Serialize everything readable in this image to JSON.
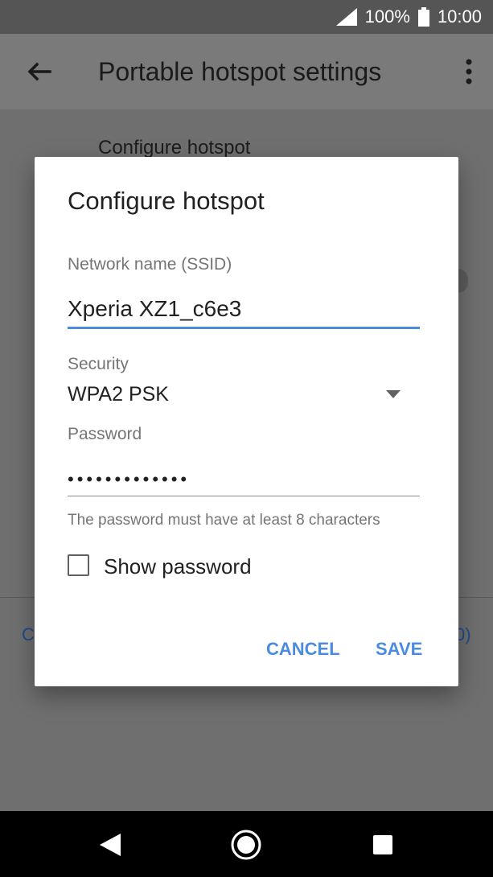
{
  "status_bar": {
    "battery": "100%",
    "time": "10:00"
  },
  "app_bar": {
    "title": "Portable hotspot settings"
  },
  "background": {
    "label": "Configure hotspot",
    "left_fragment": "C",
    "right_fragment": "0)"
  },
  "dialog": {
    "title": "Configure hotspot",
    "ssid_label": "Network name (SSID)",
    "ssid_value": "Xperia XZ1_c6e3",
    "security_label": "Security",
    "security_value": "WPA2 PSK",
    "password_label": "Password",
    "password_value": "•••••••••••••",
    "helper_text": "The password must have at least 8 characters",
    "show_password_label": "Show password",
    "show_password_checked": false,
    "cancel_label": "CANCEL",
    "save_label": "SAVE"
  },
  "colors": {
    "accent": "#4b8be0",
    "scrim": "#6f6f6f"
  }
}
